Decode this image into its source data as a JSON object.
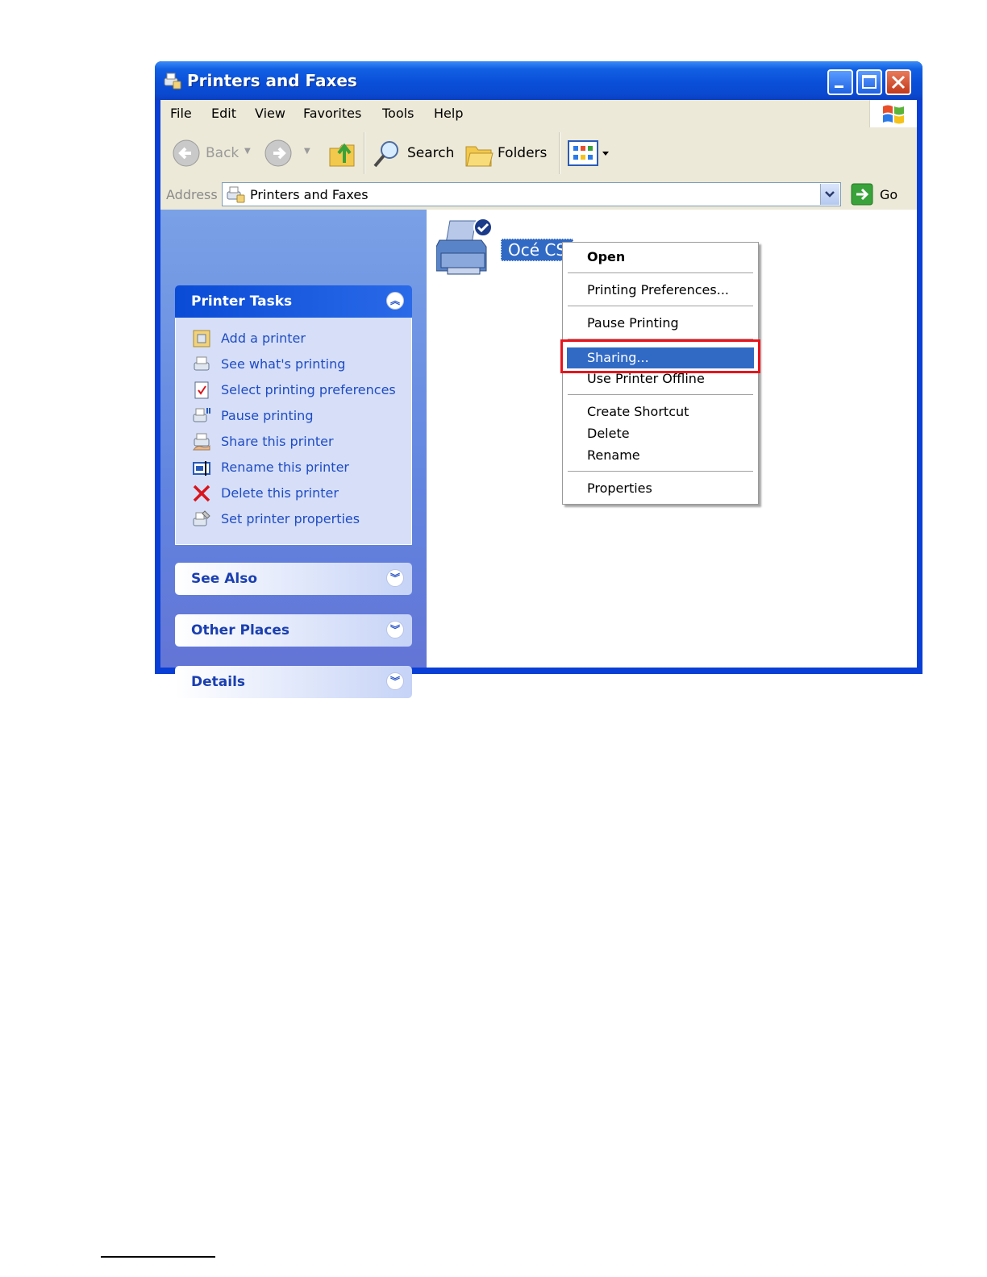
{
  "window": {
    "title": "Printers and Faxes"
  },
  "menubar": {
    "items": [
      "File",
      "Edit",
      "View",
      "Favorites",
      "Tools",
      "Help"
    ]
  },
  "toolbar": {
    "back_label": "Back",
    "search_label": "Search",
    "folders_label": "Folders"
  },
  "address": {
    "label": "Address",
    "value": "Printers and Faxes",
    "go_label": "Go"
  },
  "left_pane": {
    "printer_tasks": {
      "title": "Printer Tasks",
      "items": [
        "Add a printer",
        "See what's printing",
        "Select printing preferences",
        "Pause printing",
        "Share this printer",
        "Rename this printer",
        "Delete this printer",
        "Set printer properties"
      ]
    },
    "see_also": {
      "title": "See Also"
    },
    "other_places": {
      "title": "Other Places"
    },
    "details": {
      "title": "Details"
    }
  },
  "content": {
    "printer_name": "Océ CS"
  },
  "context_menu": {
    "open": "Open",
    "printing_preferences": "Printing Preferences...",
    "pause_printing": "Pause Printing",
    "sharing": "Sharing...",
    "use_offline": "Use Printer Offline",
    "create_shortcut": "Create Shortcut",
    "delete": "Delete",
    "rename": "Rename",
    "properties": "Properties"
  },
  "colors": {
    "titlebar": "#0a4fd8",
    "highlight": "#316ac5",
    "callout": "#e8141c",
    "task_link": "#1f4bc4"
  }
}
